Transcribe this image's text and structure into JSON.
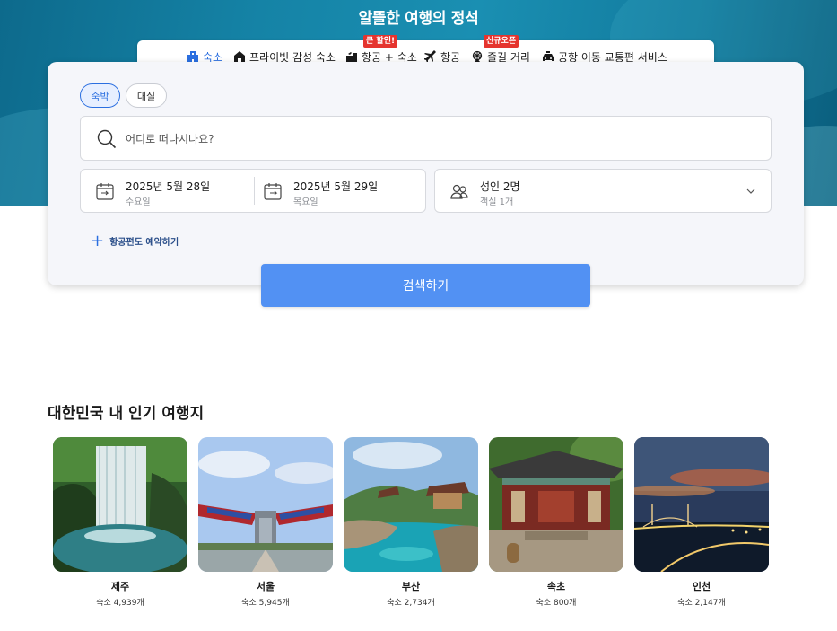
{
  "hero": {
    "title": "알뜰한 여행의 정석"
  },
  "tabs": [
    {
      "label": "숙소",
      "icon": "hotel-icon",
      "active": true
    },
    {
      "label": "프라이빗 감성 숙소",
      "icon": "house-icon"
    },
    {
      "label": "항공 + 숙소",
      "icon": "flight-hotel-icon",
      "badge": "큰 할인!"
    },
    {
      "label": "항공",
      "icon": "airplane-icon"
    },
    {
      "label": "즐길 거리",
      "icon": "ferris-wheel-icon",
      "badge": "신규오픈"
    },
    {
      "label": "공항 이동 교통편 서비스",
      "icon": "taxi-icon"
    }
  ],
  "booking": {
    "stay_type": [
      "숙박",
      "대실"
    ],
    "search_placeholder": "어디로 떠나시나요?",
    "checkin": {
      "date": "2025년 5월 28일",
      "day": "수요일"
    },
    "checkout": {
      "date": "2025년 5월 29일",
      "day": "목요일"
    },
    "guests": {
      "main": "성인 2명",
      "sub": "객실 1개"
    },
    "add_flight": "항공편도 예약하기",
    "search_button": "검색하기"
  },
  "popular": {
    "title": "대한민국 내 인기 여행지",
    "destinations": [
      {
        "name": "제주",
        "count": "숙소 4,939개"
      },
      {
        "name": "서울",
        "count": "숙소 5,945개"
      },
      {
        "name": "부산",
        "count": "숙소 2,734개"
      },
      {
        "name": "속초",
        "count": "숙소 800개"
      },
      {
        "name": "인천",
        "count": "숙소 2,147개"
      }
    ]
  },
  "colors": {
    "accent": "#2b6fe0",
    "button": "#5291f3",
    "badge": "#e5342e",
    "hero": "#1583a6"
  }
}
